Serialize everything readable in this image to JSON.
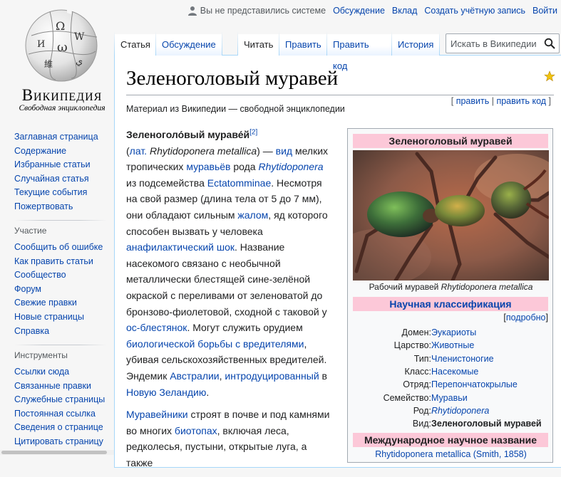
{
  "logo": {
    "wordmark": "Википедия",
    "tagline": "Свободная энциклопедия"
  },
  "personal": {
    "anon": "Вы не представились системе",
    "links": [
      "Обсуждение",
      "Вклад",
      "Создать учётную запись",
      "Войти"
    ]
  },
  "nav": {
    "main": [
      "Заглавная страница",
      "Содержание",
      "Избранные статьи",
      "Случайная статья",
      "Текущие события",
      "Пожертвовать"
    ],
    "participation_heading": "Участие",
    "participation": [
      "Сообщить об ошибке",
      "Как править статьи",
      "Сообщество",
      "Форум",
      "Свежие правки",
      "Новые страницы",
      "Справка"
    ],
    "tools_heading": "Инструменты",
    "tools": [
      "Ссылки сюда",
      "Связанные правки",
      "Служебные страницы",
      "Постоянная ссылка",
      "Сведения о странице",
      "Цитировать страницу"
    ]
  },
  "tabs": {
    "article": "Статья",
    "talk": "Обсуждение",
    "read": "Читать",
    "edit": "Править",
    "edit_source": "Править код",
    "history": "История"
  },
  "search": {
    "placeholder": "Искать в Википедии"
  },
  "article": {
    "title": "Зеленоголовый муравей",
    "edit_link": "править",
    "edit_source_link": "править код",
    "site_sub": "Материал из Википедии — свободной энциклопедии",
    "p1": {
      "name": "Зеленоголо́вый мураве́й",
      "ref": "[2]",
      "lat_abbr": "лат.",
      "lat_name": "Rhytidoponera metallica",
      "t1": ") — ",
      "vid": "вид",
      "t2": " мелких тропических ",
      "ants": "муравьёв",
      "t3": " рода ",
      "genus": "Rhytidoponera",
      "t4": " из подсемейства ",
      "subfamily": "Ectatomminae",
      "t5": ". Несмотря на свой размер (длина тела от 5 до 7 мм), они обладают сильным ",
      "sting": "жалом",
      "t6": ", яд которого способен вызвать у человека ",
      "shock": "анафилактический шок",
      "t7": ". Название насекомого связано с необычной металлически блестящей сине-зелёной окраской с переливами от зеленоватой до бронзово-фиолетовой, сходной с таковой у ",
      "beetles": "ос-блестянок",
      "t8": ". Могут служить орудием ",
      "biocontrol": "биологической борьбы с вредителями",
      "t9": ", убивая сельскохозяйственных вредителей. Эндемик ",
      "australia": "Австралии",
      "t10": ", ",
      "introduced": "интродуцированный",
      "t11": " в ",
      "nz": "Новую Зеландию",
      "t12": "."
    },
    "p2": {
      "anthills": "Муравейники",
      "t1": " строят в почве и под камнями во многих ",
      "biotopes": "биотопах",
      "t2": ", включая леса, редколесья, пустыни, открытые луга, а также"
    }
  },
  "infobox": {
    "title": "Зеленоголовый муравей",
    "caption_prefix": "Рабочий муравей ",
    "caption_species": "Rhytidoponera metallica",
    "classification_heading": "Научная классификация",
    "more": "подробно",
    "taxonomy": [
      {
        "rank": "Домен:",
        "value": "Эукариоты",
        "style": "link"
      },
      {
        "rank": "Царство:",
        "value": "Животные",
        "style": "link"
      },
      {
        "rank": "Тип:",
        "value": "Членистоногие",
        "style": "link"
      },
      {
        "rank": "Класс:",
        "value": "Насекомые",
        "style": "link"
      },
      {
        "rank": "Отряд:",
        "value": "Перепончатокрылые",
        "style": "link"
      },
      {
        "rank": "Семейство:",
        "value": "Муравьи",
        "style": "link"
      },
      {
        "rank": "Род:",
        "value": "Rhytidoponera",
        "style": "italic-link"
      },
      {
        "rank": "Вид:",
        "value": "Зеленоголовый муравей",
        "style": "current"
      }
    ],
    "intl_heading": "Международное научное название",
    "intl_name": "Rhytidoponera metallica (Smith, 1858)"
  }
}
